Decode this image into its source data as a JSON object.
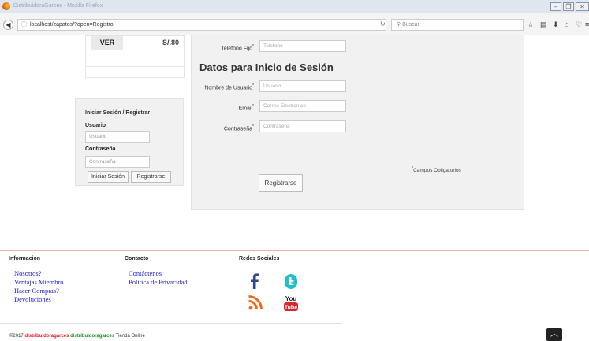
{
  "browser": {
    "window_title": "DistribuidoraGarces - Mozilla Firefox",
    "url": "localhost/zapatos/?open=Registro",
    "search_placeholder": "Buscar"
  },
  "product_card": {
    "ver_label": "VER",
    "price": "S/.80"
  },
  "login": {
    "title": "Iniciar Sesión / Registrar",
    "usuario_label": "Usuario",
    "usuario_placeholder": "Usuario",
    "contrasena_label": "Contraseña",
    "contrasena_placeholder": "Contraseña",
    "login_button": "Iniciar Sesión",
    "register_button": "Registrarse"
  },
  "form": {
    "telefono_label": "Telefono Fijo",
    "telefono_placeholder": "Telefono",
    "section_title": "Datos para Inicio de Sesión",
    "username_label": "Nombre de Usuario",
    "username_placeholder": "Usuario",
    "email_label": "Email",
    "email_placeholder": "Correo Electronico",
    "password_label": "Contraseña",
    "password_placeholder": "Contraseña",
    "required_note": "Campos Obligatorios",
    "submit_label": "Registrarse",
    "required_mark": "*"
  },
  "footer": {
    "info_title": "Informacion",
    "info_links": [
      "Nosotros?",
      "Ventajas Miembro",
      "Hacer Compras?",
      "Devoluciones"
    ],
    "contact_title": "Contacto",
    "contact_links": [
      "Contáctenos",
      "Politica de Privacidad"
    ],
    "social_title": "Redes Sociales",
    "copyright_prefix": "©2017",
    "brand_red": "distribuidoragarces",
    "brand_green": "distribuidoragarces",
    "copyright_suffix": "Tienda Online",
    "youtube_text_top": "You",
    "youtube_text_bottom": "Tube"
  },
  "icons": {
    "back": "arrow-left-icon",
    "info": "info-icon",
    "reload": "reload-icon",
    "search": "search-icon",
    "bookmark": "star-icon",
    "library": "clipboard-icon",
    "download": "download-icon",
    "home": "home-icon",
    "pocket": "pocket-icon",
    "menu": "menu-icon",
    "facebook": "facebook-icon",
    "twitter": "twitter-icon",
    "rss": "rss-icon",
    "youtube": "youtube-icon",
    "scroll_top": "chevron-up-icon"
  },
  "colors": {
    "link": "#1a1acd",
    "brand_red": "#e8161d",
    "brand_green": "#1b8a1b",
    "footer_rule": "#e8b7a6"
  }
}
